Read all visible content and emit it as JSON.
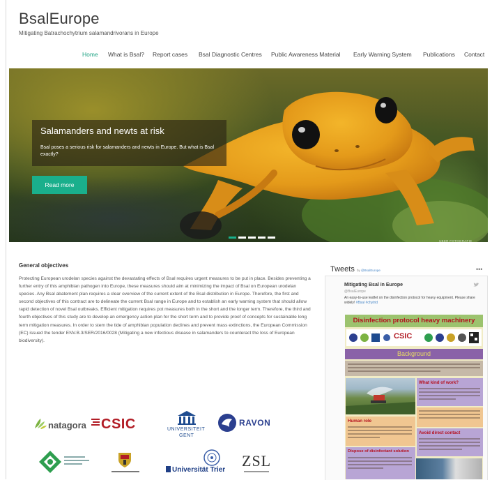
{
  "site": {
    "title": "BsalEurope",
    "tagline": "Mitigating Batrachochytrium salamandrivorans in Europe"
  },
  "nav": [
    {
      "label": "Home",
      "active": true
    },
    {
      "label": "What is Bsal?",
      "active": false
    },
    {
      "label": "Report cases",
      "active": false
    },
    {
      "label": "Bsal Diagnostic Centres",
      "active": false
    },
    {
      "label": "Public Awareness Material",
      "active": false
    },
    {
      "label": "Early Warning System",
      "active": false
    },
    {
      "label": "Publications",
      "active": false
    },
    {
      "label": "Contact",
      "active": false
    }
  ],
  "hero": {
    "caption_title": "Salamanders and newts at risk",
    "caption_text": "Bsal poses a serious risk for salamanders and newts in Europe. But what is Bsal exactly?",
    "button_label": "Read more",
    "slide_count": 5,
    "active_slide": 1,
    "photo_credit": "UBER FOTOGRAFIE"
  },
  "objectives": {
    "title": "General objectives",
    "text": "Protecting European urodelan species against the devastating effects of Bsal requires urgent measures to be put in place. Besides preventing a further entry of this amphibian pathogen into Europe, these measures should aim at minimizing the impact of Bsal on European urodelan species. Any Bsal abatement plan requires a clear overview of the current extent of the Bsal distribution in Europe. Therefore, the first and second objectives of this contract are to delineate the current Bsal range in Europe and to establish an early warning system that should allow rapid detection of novel Bsal outbreaks. Efficient mitigation requires pot measures both in the short and the longer term. Therefore, the third and fourth objectives of this study are to develop an emergency action plan for the short term and to provide proof of concepts for sustainable long term mitigation measures. In order to stem the tide of amphibian population declines and prevent mass extinctions, the European Commission (EC) issued the tender ENV.B.3/SER/2016/0028 (Mitigating a new infectious disease in salamanders to counteract the loss of European biodiversity)."
  },
  "partners": {
    "natagora": "natagora",
    "csic": "CSIC",
    "ugent_line1": "UNIVERSITEIT",
    "ugent_line2": "GENT",
    "ravon": "RAVON",
    "trier": "Universität Trier",
    "zsl": "ZSL"
  },
  "tweets": {
    "title": "Tweets",
    "by_prefix": "by",
    "handle_link": "@BsalEurope",
    "menu": "•••",
    "name": "Mitigating Bsal in Europe",
    "screen_name": "@BsalEurope",
    "text": "An easy-to-use leaflet on the disinfection protocol for heavy equipment. Please share widely!",
    "hashtag": "#Bsal #chytrid",
    "poster": {
      "headline": "Disinfection protocol heavy machinery",
      "csic": "CSIC",
      "background": "Background",
      "what_kind": "What kind of work?",
      "human_role": "Human role",
      "avoid": "Avoid direct contact",
      "dispose": "Dispose of disinfectant solution"
    }
  },
  "colors": {
    "accent": "#1aaf8c",
    "poster_green": "#9cc36e",
    "poster_purple": "#8a62a8",
    "poster_red": "#b40f1e"
  }
}
